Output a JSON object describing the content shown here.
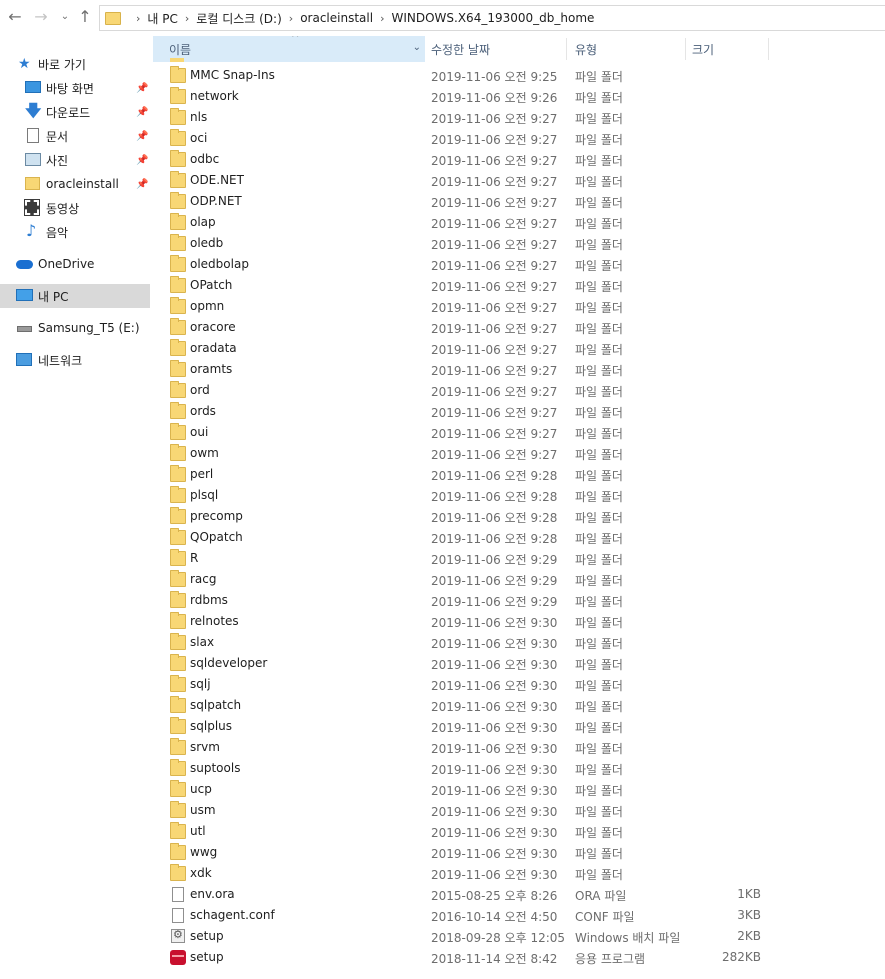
{
  "address": {
    "crumbs": [
      "내 PC",
      "로컬 디스크 (D:)",
      "oracleinstall",
      "WINDOWS.X64_193000_db_home"
    ]
  },
  "navpane": {
    "quick_access": "바로 가기",
    "items": [
      {
        "label": "바탕 화면",
        "icon": "desktop-icon"
      },
      {
        "label": "다운로드",
        "icon": "download-arrow-icon"
      },
      {
        "label": "문서",
        "icon": "documents-icon"
      },
      {
        "label": "사진",
        "icon": "pictures-icon"
      },
      {
        "label": "oracleinstall",
        "icon": "folder-icon"
      },
      {
        "label": "동영상",
        "icon": "video-icon"
      },
      {
        "label": "음악",
        "icon": "music-icon"
      }
    ],
    "onedrive": "OneDrive",
    "this_pc": "내 PC",
    "drive": "Samsung_T5 (E:)",
    "network": "네트워크"
  },
  "columns": {
    "name": "이름",
    "modified": "수정한 날짜",
    "type": "유형",
    "size": "크기"
  },
  "files": [
    {
      "name": "MMC Snap-Ins",
      "date": "2019-11-06 오전 9:25",
      "type": "파일 폴더",
      "size": "",
      "icon": "folder"
    },
    {
      "name": "network",
      "date": "2019-11-06 오전 9:26",
      "type": "파일 폴더",
      "size": "",
      "icon": "folder"
    },
    {
      "name": "nls",
      "date": "2019-11-06 오전 9:27",
      "type": "파일 폴더",
      "size": "",
      "icon": "folder"
    },
    {
      "name": "oci",
      "date": "2019-11-06 오전 9:27",
      "type": "파일 폴더",
      "size": "",
      "icon": "folder"
    },
    {
      "name": "odbc",
      "date": "2019-11-06 오전 9:27",
      "type": "파일 폴더",
      "size": "",
      "icon": "folder"
    },
    {
      "name": "ODE.NET",
      "date": "2019-11-06 오전 9:27",
      "type": "파일 폴더",
      "size": "",
      "icon": "folder"
    },
    {
      "name": "ODP.NET",
      "date": "2019-11-06 오전 9:27",
      "type": "파일 폴더",
      "size": "",
      "icon": "folder"
    },
    {
      "name": "olap",
      "date": "2019-11-06 오전 9:27",
      "type": "파일 폴더",
      "size": "",
      "icon": "folder"
    },
    {
      "name": "oledb",
      "date": "2019-11-06 오전 9:27",
      "type": "파일 폴더",
      "size": "",
      "icon": "folder"
    },
    {
      "name": "oledbolap",
      "date": "2019-11-06 오전 9:27",
      "type": "파일 폴더",
      "size": "",
      "icon": "folder"
    },
    {
      "name": "OPatch",
      "date": "2019-11-06 오전 9:27",
      "type": "파일 폴더",
      "size": "",
      "icon": "folder"
    },
    {
      "name": "opmn",
      "date": "2019-11-06 오전 9:27",
      "type": "파일 폴더",
      "size": "",
      "icon": "folder"
    },
    {
      "name": "oracore",
      "date": "2019-11-06 오전 9:27",
      "type": "파일 폴더",
      "size": "",
      "icon": "folder"
    },
    {
      "name": "oradata",
      "date": "2019-11-06 오전 9:27",
      "type": "파일 폴더",
      "size": "",
      "icon": "folder"
    },
    {
      "name": "oramts",
      "date": "2019-11-06 오전 9:27",
      "type": "파일 폴더",
      "size": "",
      "icon": "folder"
    },
    {
      "name": "ord",
      "date": "2019-11-06 오전 9:27",
      "type": "파일 폴더",
      "size": "",
      "icon": "folder"
    },
    {
      "name": "ords",
      "date": "2019-11-06 오전 9:27",
      "type": "파일 폴더",
      "size": "",
      "icon": "folder"
    },
    {
      "name": "oui",
      "date": "2019-11-06 오전 9:27",
      "type": "파일 폴더",
      "size": "",
      "icon": "folder"
    },
    {
      "name": "owm",
      "date": "2019-11-06 오전 9:27",
      "type": "파일 폴더",
      "size": "",
      "icon": "folder"
    },
    {
      "name": "perl",
      "date": "2019-11-06 오전 9:28",
      "type": "파일 폴더",
      "size": "",
      "icon": "folder"
    },
    {
      "name": "plsql",
      "date": "2019-11-06 오전 9:28",
      "type": "파일 폴더",
      "size": "",
      "icon": "folder"
    },
    {
      "name": "precomp",
      "date": "2019-11-06 오전 9:28",
      "type": "파일 폴더",
      "size": "",
      "icon": "folder"
    },
    {
      "name": "QOpatch",
      "date": "2019-11-06 오전 9:28",
      "type": "파일 폴더",
      "size": "",
      "icon": "folder"
    },
    {
      "name": "R",
      "date": "2019-11-06 오전 9:29",
      "type": "파일 폴더",
      "size": "",
      "icon": "folder"
    },
    {
      "name": "racg",
      "date": "2019-11-06 오전 9:29",
      "type": "파일 폴더",
      "size": "",
      "icon": "folder"
    },
    {
      "name": "rdbms",
      "date": "2019-11-06 오전 9:29",
      "type": "파일 폴더",
      "size": "",
      "icon": "folder"
    },
    {
      "name": "relnotes",
      "date": "2019-11-06 오전 9:30",
      "type": "파일 폴더",
      "size": "",
      "icon": "folder"
    },
    {
      "name": "slax",
      "date": "2019-11-06 오전 9:30",
      "type": "파일 폴더",
      "size": "",
      "icon": "folder"
    },
    {
      "name": "sqldeveloper",
      "date": "2019-11-06 오전 9:30",
      "type": "파일 폴더",
      "size": "",
      "icon": "folder"
    },
    {
      "name": "sqlj",
      "date": "2019-11-06 오전 9:30",
      "type": "파일 폴더",
      "size": "",
      "icon": "folder"
    },
    {
      "name": "sqlpatch",
      "date": "2019-11-06 오전 9:30",
      "type": "파일 폴더",
      "size": "",
      "icon": "folder"
    },
    {
      "name": "sqlplus",
      "date": "2019-11-06 오전 9:30",
      "type": "파일 폴더",
      "size": "",
      "icon": "folder"
    },
    {
      "name": "srvm",
      "date": "2019-11-06 오전 9:30",
      "type": "파일 폴더",
      "size": "",
      "icon": "folder"
    },
    {
      "name": "suptools",
      "date": "2019-11-06 오전 9:30",
      "type": "파일 폴더",
      "size": "",
      "icon": "folder"
    },
    {
      "name": "ucp",
      "date": "2019-11-06 오전 9:30",
      "type": "파일 폴더",
      "size": "",
      "icon": "folder"
    },
    {
      "name": "usm",
      "date": "2019-11-06 오전 9:30",
      "type": "파일 폴더",
      "size": "",
      "icon": "folder"
    },
    {
      "name": "utl",
      "date": "2019-11-06 오전 9:30",
      "type": "파일 폴더",
      "size": "",
      "icon": "folder"
    },
    {
      "name": "wwg",
      "date": "2019-11-06 오전 9:30",
      "type": "파일 폴더",
      "size": "",
      "icon": "folder"
    },
    {
      "name": "xdk",
      "date": "2019-11-06 오전 9:30",
      "type": "파일 폴더",
      "size": "",
      "icon": "folder"
    },
    {
      "name": "env.ora",
      "date": "2015-08-25 오후 8:26",
      "type": "ORA 파일",
      "size": "1KB",
      "icon": "file"
    },
    {
      "name": "schagent.conf",
      "date": "2016-10-14 오전 4:50",
      "type": "CONF 파일",
      "size": "3KB",
      "icon": "file"
    },
    {
      "name": "setup",
      "date": "2018-09-28 오후 12:05",
      "type": "Windows 배치 파일",
      "size": "2KB",
      "icon": "batch"
    },
    {
      "name": "setup",
      "date": "2018-11-14 오전 8:42",
      "type": "응용 프로그램",
      "size": "282KB",
      "icon": "exe"
    }
  ]
}
